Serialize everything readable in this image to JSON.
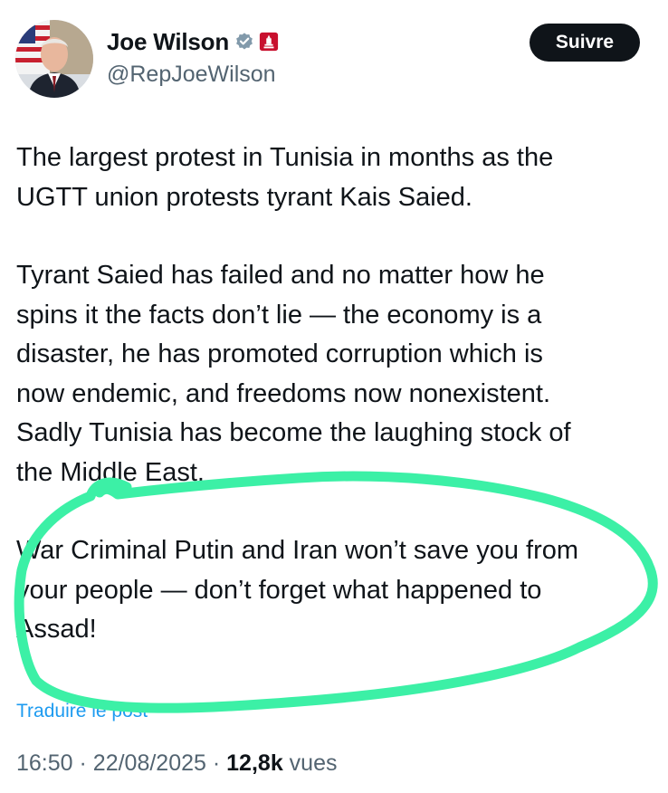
{
  "author": {
    "display_name": "Joe Wilson",
    "handle": "@RepJoeWilson",
    "verified_icon": "verified-badge-icon",
    "affiliation_icon": "us-house-seal-icon",
    "avatar": "profile-photo"
  },
  "follow_button": {
    "label": "Suivre"
  },
  "tweet": {
    "paragraph_1": "The largest protest in Tunisia in months as the\nUGTT union protests tyrant Kais Saied.",
    "paragraph_2": "Tyrant Saied has failed and no matter how he\nspins it the facts don’t lie — the economy is a\ndisaster, he has promoted corruption which is\nnow endemic, and freedoms now nonexistent.\nSadly Tunisia has become the laughing stock of\nthe Middle East.",
    "paragraph_3": "War Criminal Putin and Iran won’t save you from\nyour people — don’t forget what happened to\nAssad!"
  },
  "translate_link": "Traduire le post",
  "meta": {
    "time": "16:50",
    "separator": "·",
    "date": "22/08/2025",
    "views_count": "12,8k",
    "views_label": "vues"
  },
  "colors": {
    "text": "#0f1419",
    "secondary": "#536471",
    "link": "#1d9bf0",
    "highlight_stroke": "#3cf0a6",
    "verified": "#829aab",
    "affiliation": "#c8102e"
  }
}
